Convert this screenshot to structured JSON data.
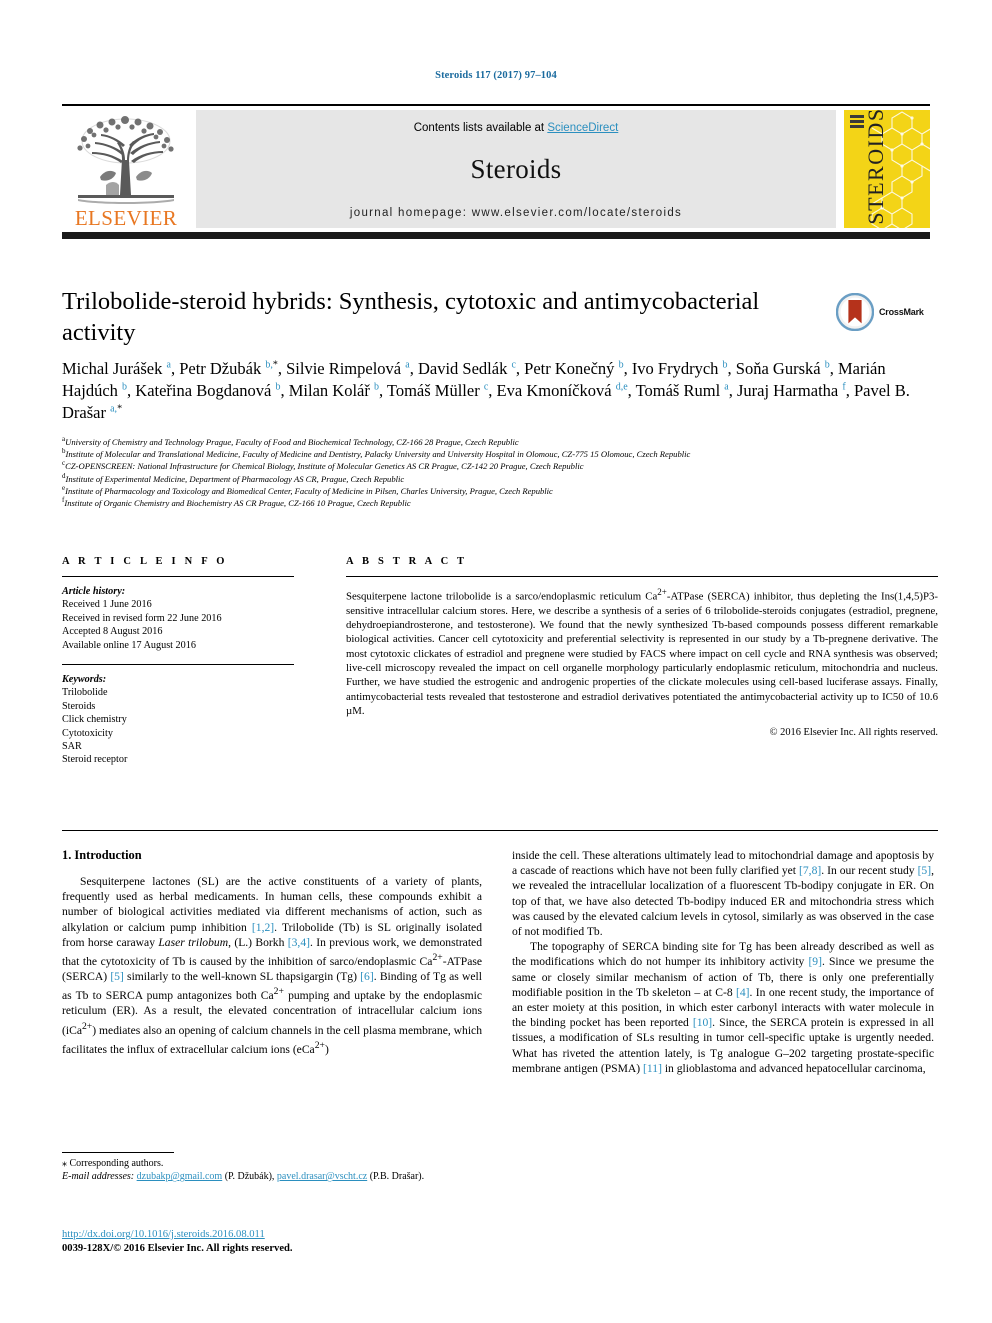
{
  "running_head": "Steroids 117 (2017) 97–104",
  "masthead": {
    "contents_prefix": "Contents lists available at ",
    "sciencedirect": "ScienceDirect",
    "journal_title": "Steroids",
    "homepage": "journal homepage: www.elsevier.com/locate/steroids",
    "publisher": "ELSEVIER",
    "cover_word": "STEROIDS",
    "brand_orange": "#E87722",
    "link_blue": "#2b8fbf",
    "cover_yellow": "#F3D417"
  },
  "article": {
    "title": "Trilobolide-steroid hybrids: Synthesis, cytotoxic and antimycobacterial activity",
    "crossmark_label": "CrossMark",
    "authors_html": "Michal Jurášek <sup>a</sup>, Petr Džubák <sup>b,</sup><sup class=\"star\">*</sup>, Silvie Rimpelová <sup>a</sup>, David Sedlák <sup>c</sup>, Petr Konečný <sup>b</sup>, Ivo Frydrych <sup>b</sup>, Soňa Gurská <sup>b</sup>, Marián Hajdúch <sup>b</sup>, Kateřina Bogdanová <sup>b</sup>, Milan Kolář <sup>b</sup>, Tomáš Müller <sup>c</sup>, Eva Kmoníčková <sup>d,e</sup>, Tomáš Ruml <sup>a</sup>, Juraj Harmatha <sup>f</sup>, Pavel B. Drašar <sup>a,</sup><sup class=\"star\">*</sup>",
    "affiliations": [
      {
        "marker": "a",
        "text": "University of Chemistry and Technology Prague, Faculty of Food and Biochemical Technology, CZ-166 28 Prague, Czech Republic"
      },
      {
        "marker": "b",
        "text": "Institute of Molecular and Translational Medicine, Faculty of Medicine and Dentistry, Palacky University and University Hospital in Olomouc, CZ-775 15 Olomouc, Czech Republic"
      },
      {
        "marker": "c",
        "text": "CZ-OPENSCREEN: National Infrastructure for Chemical Biology, Institute of Molecular Genetics AS CR Prague, CZ-142 20 Prague, Czech Republic"
      },
      {
        "marker": "d",
        "text": "Institute of Experimental Medicine, Department of Pharmacology AS CR, Prague, Czech Republic"
      },
      {
        "marker": "e",
        "text": "Institute of Pharmacology and Toxicology and Biomedical Center, Faculty of Medicine in Pilsen, Charles University, Prague, Czech Republic"
      },
      {
        "marker": "f",
        "text": "Institute of Organic Chemistry and Biochemistry AS CR Prague, CZ-166 10 Prague, Czech Republic"
      }
    ]
  },
  "info": {
    "heading": "A R T I C L E    I N F O",
    "history_label": "Article history:",
    "history": [
      "Received 1 June 2016",
      "Received in revised form 22 June 2016",
      "Accepted 8 August 2016",
      "Available online 17 August 2016"
    ],
    "keywords_label": "Keywords:",
    "keywords": [
      "Trilobolide",
      "Steroids",
      "Click chemistry",
      "Cytotoxicity",
      "SAR",
      "Steroid receptor"
    ]
  },
  "abstract": {
    "heading": "A B S T R A C T",
    "html": "Sesquiterpene lactone trilobolide is a sarco/endoplasmic reticulum Ca<sup>2+</sup>-ATPase (SERCA) inhibitor, thus depleting the Ins(1,4,5)P3-sensitive intracellular calcium stores. Here, we describe a synthesis of a series of 6 trilobolide-steroids conjugates (estradiol, pregnene, dehydroepiandrosterone, and testosterone). We found that the newly synthesized Tb-based compounds possess different remarkable biological activities. Cancer cell cytotoxicity and preferential selectivity is represented in our study by a Tb-pregnene derivative. The most cytotoxic clickates of estradiol and pregnene were studied by FACS where impact on cell cycle and RNA synthesis was observed; live-cell microscopy revealed the impact on cell organelle morphology particularly endoplasmic reticulum, mitochondria and nucleus. Further, we have studied the estrogenic and androgenic properties of the clickate molecules using cell-based luciferase assays. Finally, antimycobacterial tests revealed that testosterone and estradiol derivatives potentiated the antimycobacterial activity up to IC50 of 10.6 µM.",
    "copyright": "© 2016 Elsevier Inc. All rights reserved."
  },
  "body": {
    "section_heading": "1. Introduction",
    "left_paragraphs_html": [
      "Sesquiterpene lactones (SL) are the active constituents of a variety of plants, frequently used as herbal medicaments. In human cells, these compounds exhibit a number of biological activities mediated via different mechanisms of action, such as alkylation or calcium pump inhibition <span class=\"ref\">[1,2]</span>. Trilobolide (Tb) is SL originally isolated from horse caraway <i>Laser trilobum</i>, (L.) Borkh <span class=\"ref\">[3,4]</span>. In previous work, we demonstrated that the cytotoxicity of Tb is caused by the inhibition of sarco/endoplasmic Ca<sup>2+</sup>-ATPase (SERCA) <span class=\"ref\">[5]</span> similarly to the well-known SL thapsigargin (Tg) <span class=\"ref\">[6]</span>. Binding of Tg as well as Tb to SERCA pump antagonizes both Ca<sup>2+</sup> pumping and uptake by the endoplasmic reticulum (ER). As a result, the elevated concentration of intracellular calcium ions (iCa<sup>2+</sup>) mediates also an opening of calcium channels in the cell plasma membrane, which facilitates the influx of extracellular calcium ions (eCa<sup>2+</sup>)"
    ],
    "right_paragraphs_html": [
      "inside the cell. These alterations ultimately lead to mitochondrial damage and apoptosis by a cascade of reactions which have not been fully clarified yet <span class=\"ref\">[7,8]</span>. In our recent study <span class=\"ref\">[5]</span>, we revealed the intracellular localization of a fluorescent Tb-bodipy conjugate in ER. On top of that, we have also detected Tb-bodipy induced ER and mitochondria stress which was caused by the elevated calcium levels in cytosol, similarly as was observed in the case of not modified Tb.",
      "The topography of SERCA binding site for Tg has been already described as well as the modifications which do not humper its inhibitory activity <span class=\"ref\">[9]</span>. Since we presume the same or closely similar mechanism of action of Tb, there is only one preferentially modifiable position in the Tb skeleton – at C-8 <span class=\"ref\">[4]</span>. In one recent study, the importance of an ester moiety at this position, in which ester carbonyl interacts with water molecule in the binding pocket has been reported <span class=\"ref\">[10]</span>. Since, the SERCA protein is expressed in all tissues, a modification of SLs resulting in tumor cell-specific uptake is urgently needed. What has riveted the attention lately, is Tg analogue G–202 targeting prostate-specific membrane antigen (PSMA) <span class=\"ref\">[11]</span> in glioblastoma and advanced hepatocellular carcinoma,"
    ]
  },
  "footer": {
    "corresponding_marker": "⁎",
    "corresponding_text": "Corresponding authors.",
    "email_label": "E-mail addresses:",
    "email_1": "dzubakp@gmail.com",
    "email_1_owner": "(P. Džubák),",
    "email_2": "pavel.drasar@vscht.cz",
    "email_2_owner": "(P.B. Drašar).",
    "doi": "http://dx.doi.org/10.1016/j.steroids.2016.08.011",
    "issn_line": "0039-128X/© 2016 Elsevier Inc. All rights reserved."
  }
}
